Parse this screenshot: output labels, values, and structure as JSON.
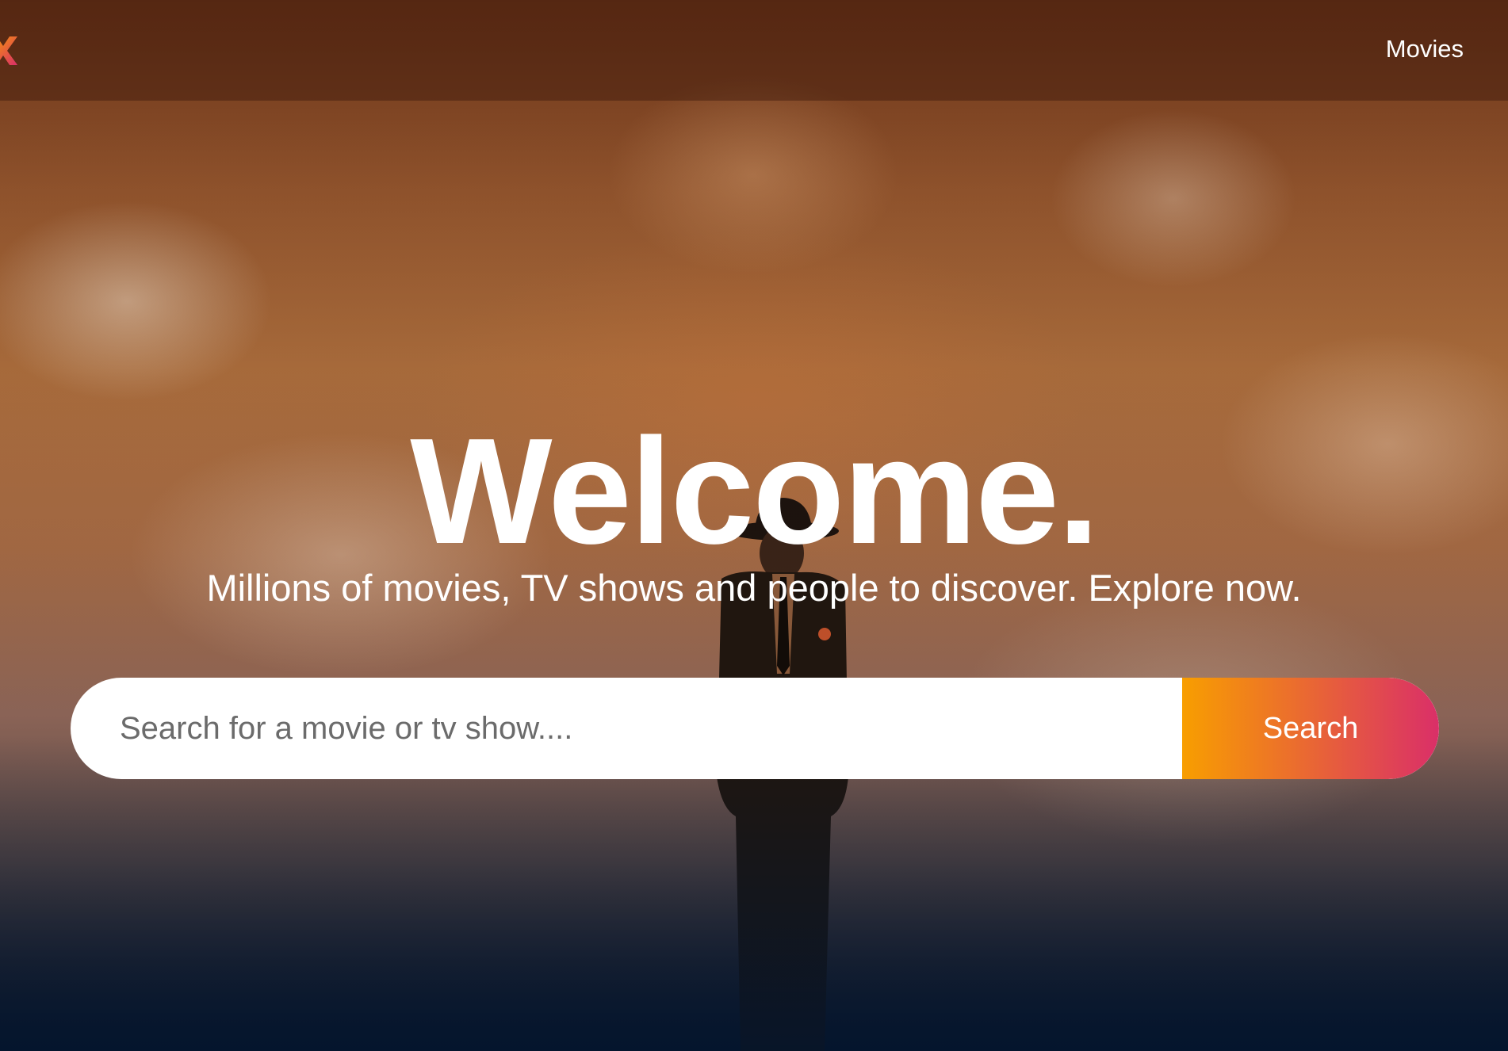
{
  "header": {
    "nav": {
      "movies_label": "Movies"
    }
  },
  "hero": {
    "title": "Welcome.",
    "subtitle": "Millions of movies, TV shows and people to discover. Explore now.",
    "search": {
      "placeholder": "Search for a movie or tv show....",
      "value": "",
      "button_label": "Search"
    }
  },
  "colors": {
    "accent_start": "#f89e00",
    "accent_end": "#da2f68",
    "page_background": "#04152d",
    "text": "#ffffff"
  },
  "icons": {
    "logo": "logo-mark-icon"
  }
}
